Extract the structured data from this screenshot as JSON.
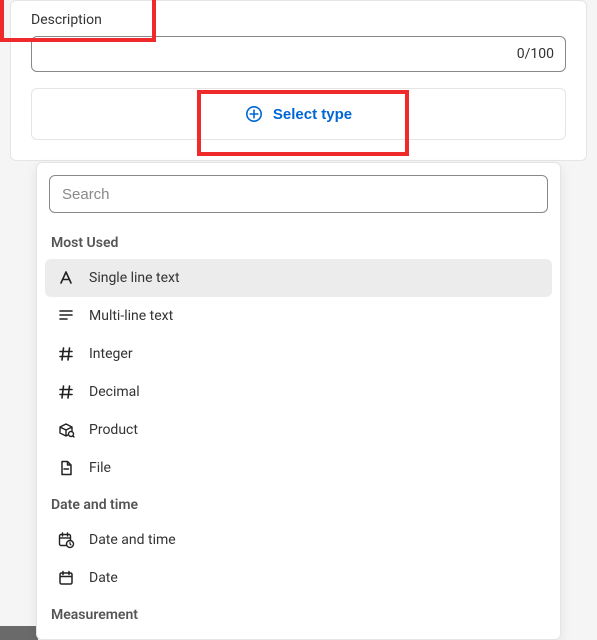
{
  "field": {
    "label": "Description",
    "value": "",
    "counter": "0/100"
  },
  "select_type": {
    "label": "Select type"
  },
  "search": {
    "placeholder": "Search",
    "value": ""
  },
  "sections": [
    {
      "title": "Most Used",
      "options": [
        {
          "icon": "text-a-icon",
          "label": "Single line text",
          "highlighted": true
        },
        {
          "icon": "multiline-icon",
          "label": "Multi-line text",
          "highlighted": false
        },
        {
          "icon": "hash-icon",
          "label": "Integer",
          "highlighted": false
        },
        {
          "icon": "hash-icon",
          "label": "Decimal",
          "highlighted": false
        },
        {
          "icon": "product-icon",
          "label": "Product",
          "highlighted": false
        },
        {
          "icon": "file-icon",
          "label": "File",
          "highlighted": false
        }
      ]
    },
    {
      "title": "Date and time",
      "options": [
        {
          "icon": "datetime-icon",
          "label": "Date and time",
          "highlighted": false
        },
        {
          "icon": "date-icon",
          "label": "Date",
          "highlighted": false
        }
      ]
    },
    {
      "title": "Measurement",
      "options": []
    }
  ]
}
